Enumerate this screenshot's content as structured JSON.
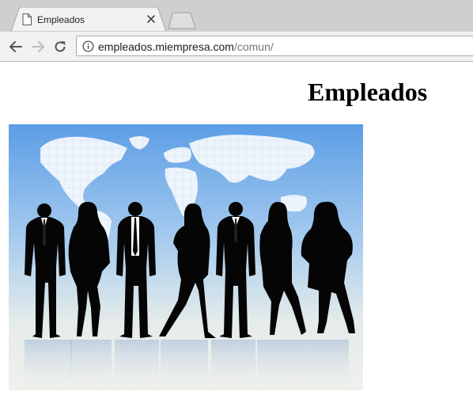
{
  "browser": {
    "tab": {
      "title": "Empleados",
      "icon": "document-icon",
      "close_icon": "close-icon"
    },
    "toolbar": {
      "back_icon": "arrow-left-icon",
      "forward_icon": "arrow-right-icon",
      "reload_icon": "reload-icon",
      "site_info_icon": "info-icon",
      "url_host": "empleados.miempresa.com",
      "url_path": "/comun/"
    }
  },
  "page": {
    "heading": "Empleados",
    "hero_image": {
      "subject": "silhouettes of seven business people standing in front of a world map",
      "colors": {
        "sky_top": "#5b9de6",
        "sky_bottom": "#eef0ec",
        "silhouette": "#050505"
      }
    }
  }
}
